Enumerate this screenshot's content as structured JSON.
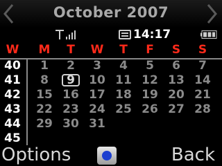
{
  "header": {
    "title": "October 2007",
    "prev_icon": "chevron-left-icon",
    "next_icon": "chevron-right-icon"
  },
  "status_bar": {
    "signal_icon": "signal-strength-icon",
    "calendar_icon": "calendar-icon",
    "time": "14:17",
    "battery_icon": "battery-icon"
  },
  "calendar": {
    "week_label": "W",
    "weekdays": [
      "M",
      "T",
      "W",
      "T",
      "F",
      "S",
      "S"
    ],
    "weekday_color": "#ff2a1a",
    "selected_day": "9",
    "weeks": [
      {
        "week": "40",
        "days": [
          "1",
          "2",
          "3",
          "4",
          "5",
          "6",
          "7"
        ]
      },
      {
        "week": "41",
        "days": [
          "8",
          "9",
          "10",
          "11",
          "12",
          "13",
          "14"
        ]
      },
      {
        "week": "42",
        "days": [
          "15",
          "16",
          "17",
          "18",
          "19",
          "20",
          "21"
        ]
      },
      {
        "week": "43",
        "days": [
          "22",
          "23",
          "24",
          "25",
          "26",
          "27",
          "28"
        ]
      },
      {
        "week": "44",
        "days": [
          "29",
          "30",
          "31",
          "",
          "",
          "",
          ""
        ]
      },
      {
        "week": "45",
        "days": [
          "",
          "",
          "",
          "",
          "",
          "",
          ""
        ]
      }
    ]
  },
  "softkeys": {
    "left_label": "Options",
    "center_icon": "center-select-key-icon",
    "right_label": "Back"
  }
}
